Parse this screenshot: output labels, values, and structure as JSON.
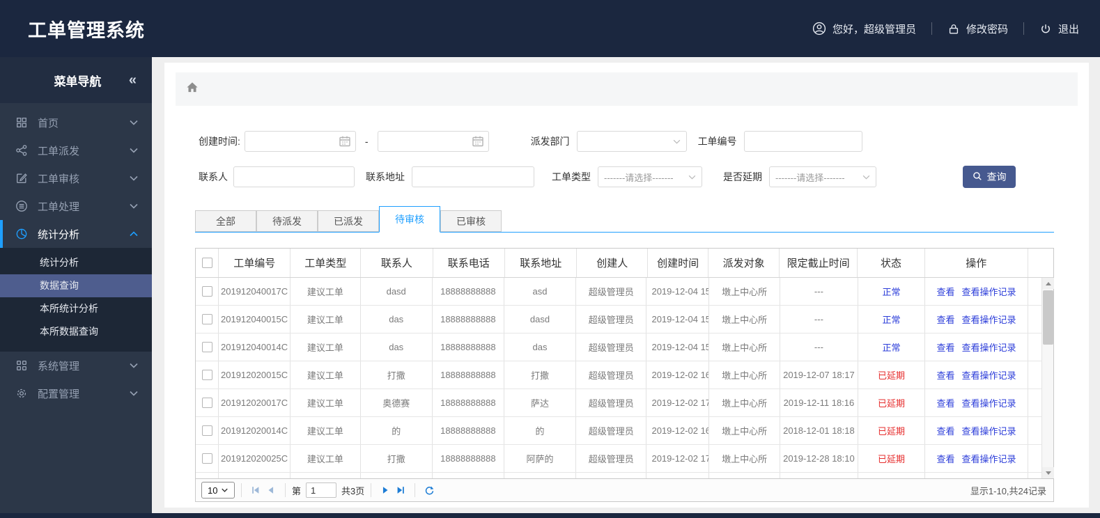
{
  "header": {
    "title": "工单管理系统",
    "user_greeting": "您好，超级管理员",
    "change_password": "修改密码",
    "logout": "退出"
  },
  "sidebar": {
    "title": "菜单导航",
    "collapse_glyph": "«",
    "items": [
      {
        "label": "首页"
      },
      {
        "label": "工单派发"
      },
      {
        "label": "工单审核"
      },
      {
        "label": "工单处理"
      },
      {
        "label": "统计分析",
        "active": true,
        "expanded": true,
        "children": [
          {
            "label": "统计分析"
          },
          {
            "label": "数据查询",
            "active": true
          },
          {
            "label": "本所统计分析"
          },
          {
            "label": "本所数据查询"
          }
        ]
      },
      {
        "label": "系统管理"
      },
      {
        "label": "配置管理"
      }
    ]
  },
  "filters": {
    "create_time_label": "创建时间:",
    "date_separator": "-",
    "dispatch_dept_label": "派发部门",
    "order_no_label": "工单编号",
    "contact_label": "联系人",
    "address_label": "联系地址",
    "order_type_label": "工单类型",
    "order_type_value": "-------请选择-------",
    "delay_label": "是否延期",
    "delay_value": "-------请选择-------",
    "search_button": "查询"
  },
  "tabs": [
    {
      "label": "全部"
    },
    {
      "label": "待派发"
    },
    {
      "label": "已派发"
    },
    {
      "label": "待审核",
      "active": true
    },
    {
      "label": "已审核"
    }
  ],
  "table": {
    "columns": [
      "工单编号",
      "工单类型",
      "联系人",
      "联系电话",
      "联系地址",
      "创建人",
      "创建时间",
      "派发对象",
      "限定截止时间",
      "状态",
      "操作"
    ],
    "action_view": "查看",
    "action_log": "查看操作记录",
    "rows": [
      {
        "order_no": "201912040017C",
        "type": "建议工单",
        "contact": "dasd",
        "phone": "18888888888",
        "address": "asd",
        "creator": "超级管理员",
        "created": "2019-12-04 15",
        "target": "墩上中心所",
        "deadline": "---",
        "status": "正常",
        "status_class": "normal"
      },
      {
        "order_no": "201912040015C",
        "type": "建议工单",
        "contact": "das",
        "phone": "18888888888",
        "address": "dasd",
        "creator": "超级管理员",
        "created": "2019-12-04 15",
        "target": "墩上中心所",
        "deadline": "---",
        "status": "正常",
        "status_class": "normal"
      },
      {
        "order_no": "201912040014C",
        "type": "建议工单",
        "contact": "das",
        "phone": "18888888888",
        "address": "das",
        "creator": "超级管理员",
        "created": "2019-12-04 15",
        "target": "墩上中心所",
        "deadline": "---",
        "status": "正常",
        "status_class": "normal"
      },
      {
        "order_no": "201912020015C",
        "type": "建议工单",
        "contact": "打撒",
        "phone": "18888888888",
        "address": "打撒",
        "creator": "超级管理员",
        "created": "2019-12-02 16",
        "target": "墩上中心所",
        "deadline": "2019-12-07 18:17",
        "status": "已延期",
        "status_class": "delayed"
      },
      {
        "order_no": "201912020017C",
        "type": "建议工单",
        "contact": "奥德赛",
        "phone": "18888888888",
        "address": "萨达",
        "creator": "超级管理员",
        "created": "2019-12-02 17",
        "target": "墩上中心所",
        "deadline": "2019-12-11 18:16",
        "status": "已延期",
        "status_class": "delayed"
      },
      {
        "order_no": "201912020014C",
        "type": "建议工单",
        "contact": "的",
        "phone": "18888888888",
        "address": "的",
        "creator": "超级管理员",
        "created": "2019-12-02 16",
        "target": "墩上中心所",
        "deadline": "2018-12-01 18:18",
        "status": "已延期",
        "status_class": "delayed"
      },
      {
        "order_no": "201912020025C",
        "type": "建议工单",
        "contact": "打撒",
        "phone": "18888888888",
        "address": "阿萨的",
        "creator": "超级管理员",
        "created": "2019-12-02 17",
        "target": "墩上中心所",
        "deadline": "2019-12-28 18:10",
        "status": "已延期",
        "status_class": "delayed"
      }
    ]
  },
  "pagination": {
    "page_size": "10",
    "page_prefix": "第",
    "current_page": "1",
    "total_pages": "共3页",
    "summary": "显示1-10,共24记录"
  },
  "colors": {
    "accent_blue": "#1e9fff",
    "link_blue": "#2b3cd9",
    "status_delayed_red": "#e62c2c",
    "search_button": "#46598f",
    "header_navy": "#1b273f",
    "sidebar_slate": "#2c3748"
  }
}
